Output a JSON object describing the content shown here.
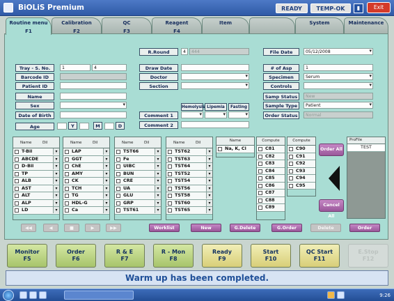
{
  "title_bar": {
    "app_title": "BiOLiS Premium",
    "status_ready": "READY",
    "status_temp": "TEMP-OK",
    "exit_label": "Exit"
  },
  "tabs": [
    {
      "label": "Routine menu",
      "key": "F1",
      "active": true
    },
    {
      "label": "Calibration",
      "key": "F2",
      "active": false
    },
    {
      "label": "QC",
      "key": "F3",
      "active": false
    },
    {
      "label": "Reagent",
      "key": "F4",
      "active": false
    },
    {
      "label": "Item",
      "key": "",
      "active": false
    },
    {
      "label": "",
      "key": "",
      "active": false
    },
    {
      "label": "System",
      "key": "",
      "active": false
    },
    {
      "label": "Maintenance",
      "key": "",
      "active": false
    }
  ],
  "patient_form": {
    "tray_sno_label": "Tray - S. No.",
    "tray_value": "1",
    "sno_value": "4",
    "barcode_label": "Barcode ID",
    "patient_id_label": "Patient ID",
    "name_label": "Name",
    "sex_label": "Sex",
    "dob_label": "Date of Birth",
    "age_label": "Age",
    "age_y": "Y",
    "age_m": "M",
    "age_d": "D"
  },
  "round_form": {
    "rround_label": "R.Round",
    "rround_value": "4",
    "rround_gray": "444",
    "draw_date_label": "Draw Date",
    "doctor_label": "Doctor",
    "section_label": "Section",
    "comment1_label": "Comment 1",
    "comment2_label": "Comment 2",
    "hemolysis_label": "Hemolysis",
    "lipemia_label": "Lipemia",
    "fasting_label": "Fasting"
  },
  "sample_form": {
    "file_date_label": "File Date",
    "file_date_value": "05/12/2008",
    "num_asp_label": "# of Asp",
    "num_asp_value": "1",
    "specimen_label": "Specimen",
    "specimen_value": "Serum",
    "controls_label": "Controls",
    "samp_status_label": "Samp Status",
    "samp_status_value": "New",
    "sample_type_label": "Sample Type",
    "sample_type_value": "Patient",
    "order_status_label": "Order Status",
    "order_status_value": "Normal"
  },
  "test_columns": [
    {
      "header_name": "Name",
      "header_dil": "Dil",
      "items": [
        "T-Bil",
        "ABCDE",
        "D-Bil",
        "TP",
        "ALB",
        "AST",
        "ALT",
        "ALP",
        "LD"
      ]
    },
    {
      "header_name": "Name",
      "header_dil": "Dil",
      "items": [
        "LAP",
        "GGT",
        "ChE",
        "AMY",
        "CK",
        "TCH",
        "TG",
        "HDL-G",
        "Ca"
      ]
    },
    {
      "header_name": "Name",
      "header_dil": "Dil",
      "items": [
        "TST66",
        "Fe",
        "UIBC",
        "BUN",
        "CRE",
        "UA",
        "GLU",
        "GRP",
        "TST61"
      ]
    },
    {
      "header_name": "Name",
      "header_dil": "Dil",
      "items": [
        "TST62",
        "TST63",
        "TST64",
        "TST52",
        "TST54",
        "TST56",
        "TST58",
        "TST60",
        "TST65"
      ]
    }
  ],
  "electrolyte_col": {
    "header": "Name",
    "items": [
      "Na, K, Cl"
    ]
  },
  "compute_cols": [
    {
      "header": "Compute",
      "items": [
        "C81",
        "C82",
        "C83",
        "C84",
        "C85",
        "C86",
        "C87",
        "C88",
        "C89"
      ]
    },
    {
      "header": "Compute",
      "items": [
        "C90",
        "C91",
        "C92",
        "C93",
        "C94",
        "C95"
      ]
    }
  ],
  "profile": {
    "header": "ProFile",
    "items": [
      "TEST"
    ]
  },
  "side_buttons": {
    "order_all": "Order All",
    "cancel_all": "Cancel All"
  },
  "bottom_buttons": {
    "worklist": "Worklist",
    "new": "New",
    "g_delete": "G.Delete",
    "g_order": "G.Order",
    "delete": "Delete",
    "order": "Order"
  },
  "function_keys": [
    {
      "label": "Monitor",
      "key": "F5",
      "style": "green"
    },
    {
      "label": "Order",
      "key": "F6",
      "style": "green"
    },
    {
      "label": "R & E",
      "key": "F7",
      "style": "green"
    },
    {
      "label": "R - Mon",
      "key": "F8",
      "style": "green"
    },
    {
      "label": "Ready",
      "key": "F9",
      "style": "yellow"
    },
    {
      "label": "Start",
      "key": "F10",
      "style": "yellow"
    },
    {
      "label": "QC Start",
      "key": "F11",
      "style": "yellow"
    },
    {
      "label": "E.Stop",
      "key": "F12",
      "style": "dis"
    }
  ],
  "message": "Warm up has been completed.",
  "taskbar": {
    "clock": "9:26"
  },
  "colors": {
    "panel": "#a9ddd4",
    "button_purple": "#9a579a",
    "title_blue": "#2f5aa6"
  }
}
